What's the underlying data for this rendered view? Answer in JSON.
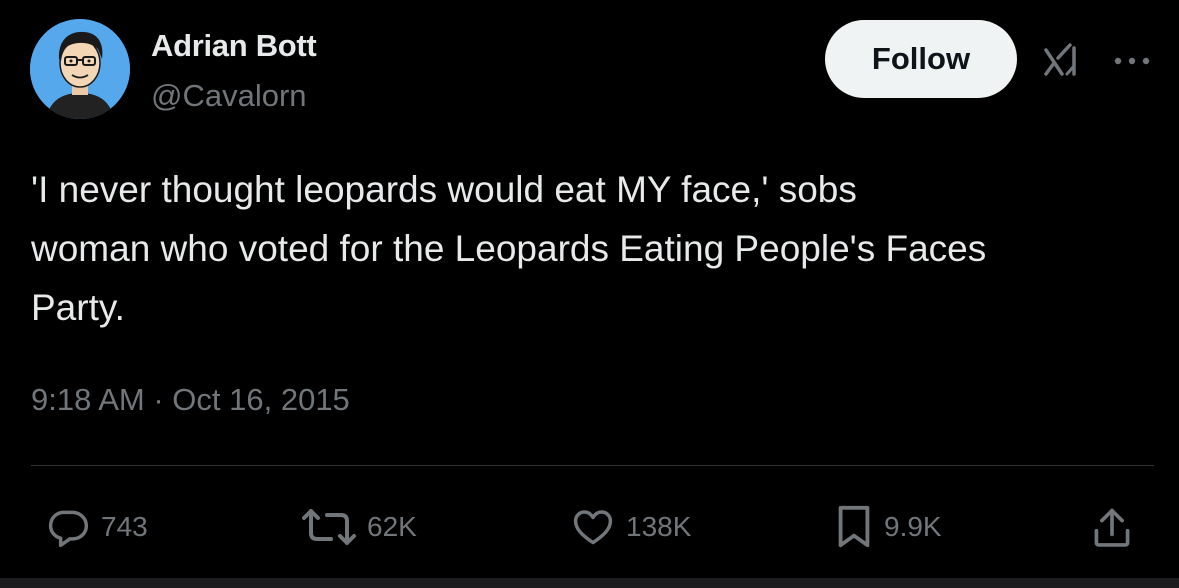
{
  "author": {
    "display_name": "Adrian Bott",
    "handle": "@Cavalorn",
    "avatar_icon": "cartoon-avatar",
    "avatar_bg": "#56a8ec"
  },
  "header": {
    "follow_label": "Follow",
    "grok_icon": "grok-icon",
    "more_icon": "more-icon"
  },
  "tweet": {
    "lines": [
      "'I never thought leopards would eat MY face,' sobs",
      "woman who voted for the Leopards Eating People's Faces",
      "Party."
    ],
    "timestamp": "9:18 AM · Oct 16, 2015"
  },
  "actions": {
    "reply": {
      "icon": "reply-icon",
      "count": "743"
    },
    "retweet": {
      "icon": "retweet-icon",
      "count": "62K"
    },
    "like": {
      "icon": "heart-icon",
      "count": "138K"
    },
    "bookmark": {
      "icon": "bookmark-icon",
      "count": "9.9K"
    },
    "share": {
      "icon": "share-icon"
    }
  },
  "colors": {
    "background": "#000000",
    "text_primary": "#e7e9ea",
    "text_secondary": "#71767b",
    "divider": "#2f3336",
    "follow_bg": "#eff3f4"
  }
}
